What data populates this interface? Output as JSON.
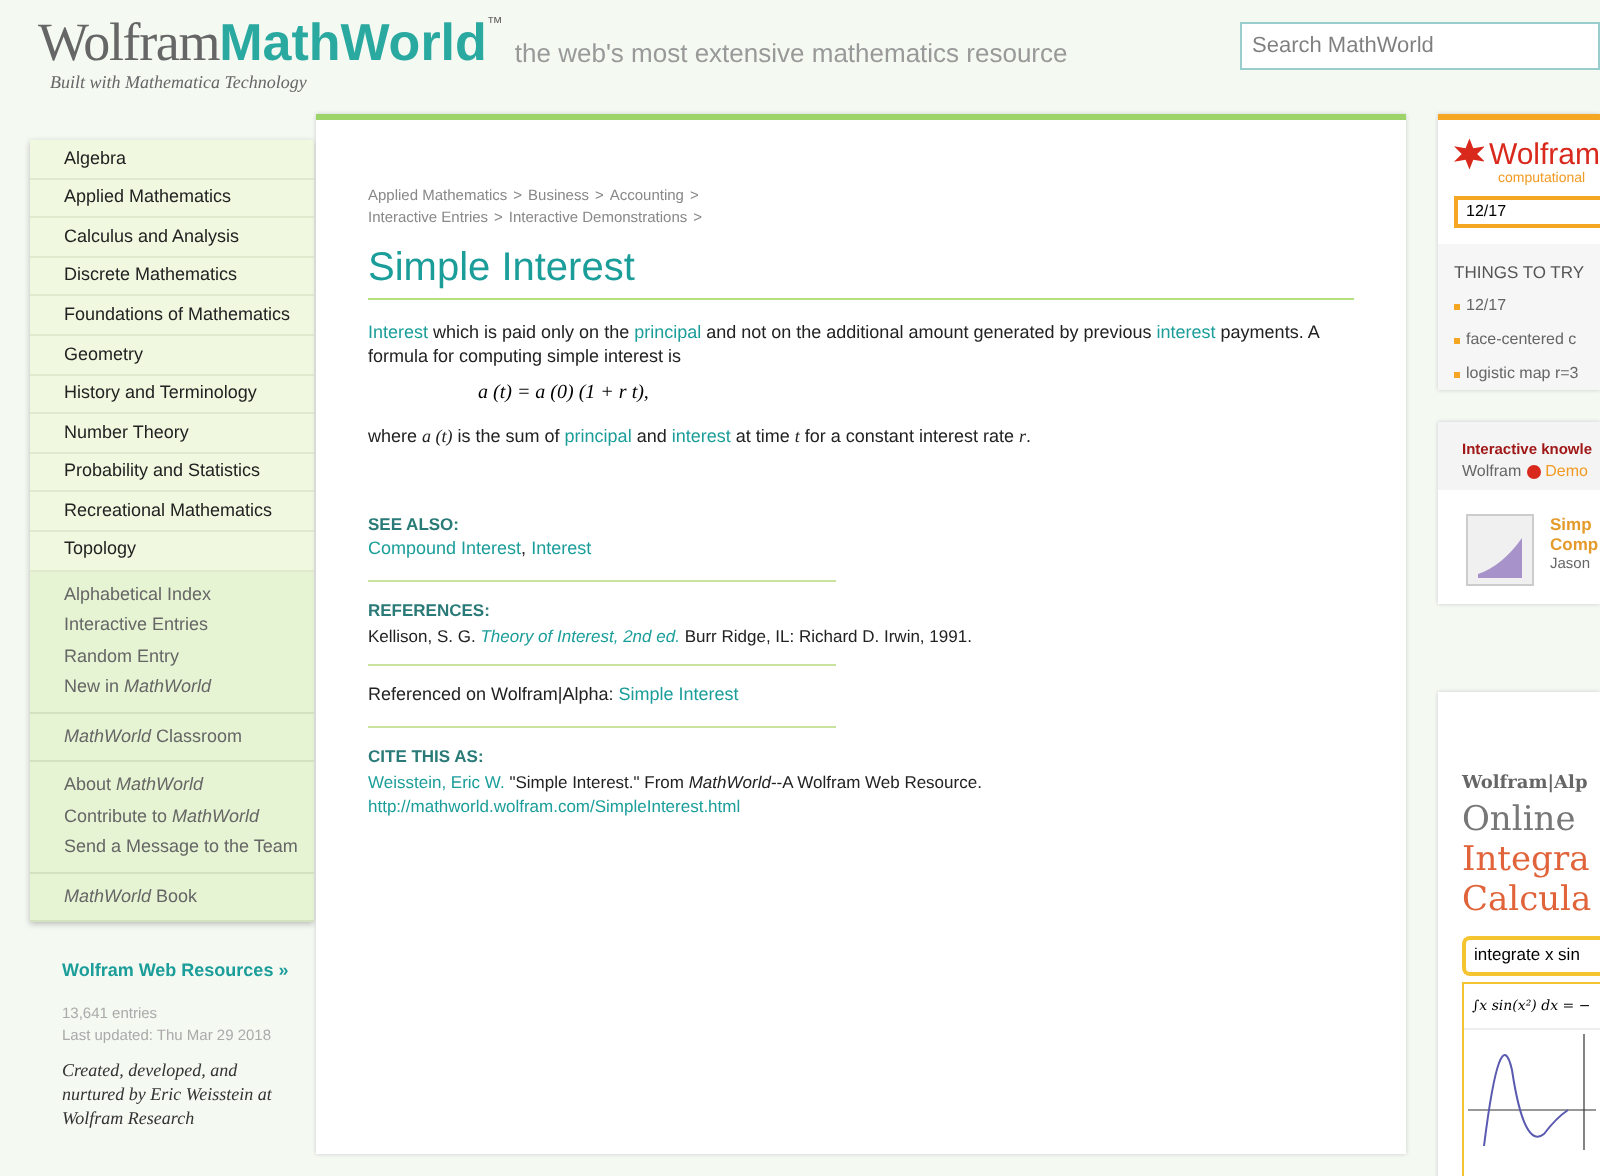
{
  "header": {
    "logo_left": "Wolfram",
    "logo_right": "MathWorld",
    "logo_tm": "™",
    "tagline_logo": "Built with Mathematica Technology",
    "tagline": "the web's most extensive mathematics resource",
    "search": {
      "placeholder": "Search MathWorld"
    }
  },
  "sidebar": {
    "topics": [
      "Algebra",
      "Applied Mathematics",
      "Calculus and Analysis",
      "Discrete Mathematics",
      "Foundations of Mathematics",
      "Geometry",
      "History and Terminology",
      "Number Theory",
      "Probability and Statistics",
      "Recreational Mathematics",
      "Topology"
    ],
    "groups": [
      [
        "Alphabetical Index",
        "Interactive Entries",
        "Random Entry",
        "New in *MathWorld*"
      ],
      [
        "*MathWorld* Classroom"
      ],
      [
        "About *MathWorld*",
        "Contribute to *MathWorld*",
        "Send a Message to the Team"
      ],
      [
        "*MathWorld* Book"
      ]
    ],
    "resources_link": "Wolfram Web Resources »",
    "entries": "13,641 entries",
    "updated": "Last updated: Thu Mar 29 2018",
    "credit": "Created, developed, and nurtured by Eric Weisstein at Wolfram Research"
  },
  "article": {
    "breadcrumbs": [
      [
        "Applied Mathematics",
        "Business",
        "Accounting"
      ],
      [
        "Interactive Entries",
        "Interactive Demonstrations"
      ]
    ],
    "separator": ">",
    "title": "Simple Interest",
    "intro": [
      {
        "kind": "link",
        "text": "Interest"
      },
      {
        "kind": "text",
        "text": " which is paid only on the "
      },
      {
        "kind": "link",
        "text": "principal"
      },
      {
        "kind": "text",
        "text": " and not on the additional amount generated by previous "
      },
      {
        "kind": "link",
        "text": "interest"
      },
      {
        "kind": "text",
        "text": " payments. A formula for computing simple interest is"
      }
    ],
    "formula": "a (t) = a (0) (1 + r t),",
    "explanation": [
      {
        "kind": "text",
        "text": "where "
      },
      {
        "kind": "math",
        "text": "a (t)"
      },
      {
        "kind": "text",
        "text": " is the sum of "
      },
      {
        "kind": "link",
        "text": "principal"
      },
      {
        "kind": "text",
        "text": " and "
      },
      {
        "kind": "link",
        "text": "interest"
      },
      {
        "kind": "text",
        "text": " at time "
      },
      {
        "kind": "math",
        "text": "t"
      },
      {
        "kind": "text",
        "text": " for a constant interest rate "
      },
      {
        "kind": "math",
        "text": "r"
      },
      {
        "kind": "text",
        "text": "."
      }
    ],
    "see_also": {
      "heading": "SEE ALSO:",
      "links": [
        "Compound Interest",
        "Interest"
      ],
      "separator": ","
    },
    "references": {
      "heading": "REFERENCES:",
      "author": "Kellison, S. G.",
      "book": "Theory of Interest, 2nd ed.",
      "rest": "Burr Ridge, IL: Richard D. Irwin, 1991."
    },
    "alpha": {
      "label": "Referenced on Wolfram|Alpha:",
      "link": "Simple Interest"
    },
    "cite": {
      "heading": "CITE THIS AS:",
      "author": "Weisstein, Eric W.",
      "text": "\"Simple Interest.\" From *MathWorld*--A Wolfram Web Resource.",
      "url": "http://mathworld.wolfram.com/SimpleInterest.html"
    }
  },
  "right": {
    "alpha_logo": "Wolfram",
    "alpha_sub": "computational",
    "alpha_input": "12/17",
    "things_heading": "THINGS TO TRY",
    "things": [
      "12/17",
      "face-centered c",
      "logistic map r=3"
    ],
    "demo_heading": "Interactive knowle",
    "demo_brand": "Wolfram",
    "demo_brand2": "Demo",
    "demo_title": [
      "Simp",
      "Comp"
    ],
    "demo_author": "Jason",
    "ad_brand": "Wolfram|Alp",
    "ad_line1": "Online",
    "ad_line2": "Integra",
    "ad_line3": "Calcula",
    "ad_input": "integrate x sin",
    "ad_result": "∫x sin(x²) dx = −"
  }
}
